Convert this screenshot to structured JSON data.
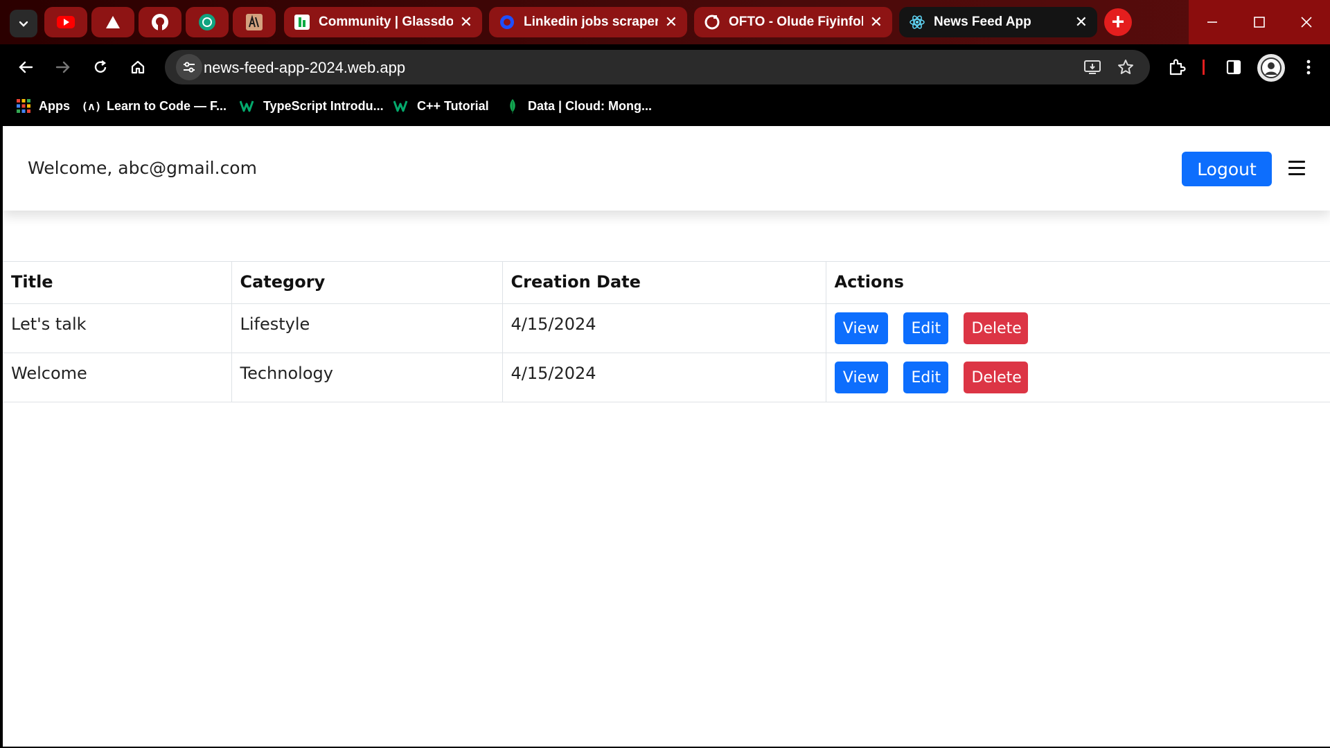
{
  "browser": {
    "tabs": [
      {
        "title": "Community | Glassdoor",
        "active": false
      },
      {
        "title": "Linkedin jobs scraper A",
        "active": false
      },
      {
        "title": "OFTO - Olude Fiyinfolu",
        "active": false
      },
      {
        "title": "News Feed App",
        "active": true
      }
    ],
    "close_glyph": "✕",
    "new_tab_glyph": "+",
    "url": "news-feed-app-2024.web.app",
    "bookmarks": [
      {
        "label": "Apps",
        "icon": "apps-grid-icon"
      },
      {
        "label": "Learn to Code — F...",
        "icon": "freecodecamp-icon"
      },
      {
        "label": "TypeScript Introdu...",
        "icon": "w3schools-icon"
      },
      {
        "label": "C++ Tutorial",
        "icon": "w3schools-icon"
      },
      {
        "label": "Data | Cloud: Mong...",
        "icon": "mongodb-leaf-icon"
      }
    ],
    "colors": {
      "tab_bg": "#8e1414",
      "active_tab": "#141414",
      "new_tab": "#e41e1e"
    }
  },
  "app": {
    "welcome_text": "Welcome, abc@gmail.com",
    "logout_label": "Logout",
    "table": {
      "headers": [
        "Title",
        "Category",
        "Creation Date",
        "Actions"
      ],
      "rows": [
        {
          "title": "Let's talk",
          "category": "Lifestyle",
          "date": "4/15/2024"
        },
        {
          "title": "Welcome",
          "category": "Technology",
          "date": "4/15/2024"
        }
      ],
      "actions": {
        "view": "View",
        "edit": "Edit",
        "delete": "Delete"
      }
    },
    "colors": {
      "primary": "#0d6efd",
      "danger": "#dc3545"
    }
  }
}
